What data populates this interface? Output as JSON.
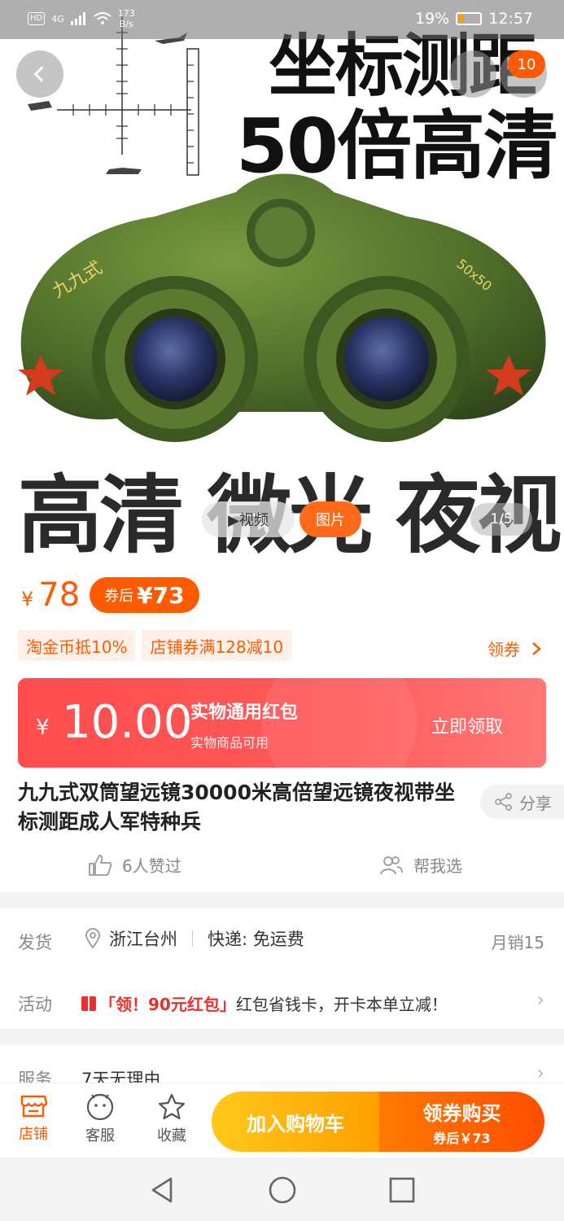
{
  "status_bar": {
    "hd": "HD",
    "network": "4G",
    "speed_value": "173",
    "speed_unit": "B/s",
    "battery": "19%",
    "time": "12:57"
  },
  "hero": {
    "title_line1": "坐标测距",
    "title_line2": "50倍高清",
    "bottom_text": "高清 微光 夜视",
    "cart_badge": "10",
    "tab_video": "▶视频",
    "tab_picture": "图片",
    "page_indicator": "1/5",
    "binocular_model_text": "九九式",
    "binocular_spec_text": "50x50"
  },
  "price": {
    "symbol": "¥",
    "value": "78",
    "coupon_label": "券后",
    "coupon_value": "¥73"
  },
  "tags": [
    "淘金币抵10%",
    "店铺券满128减10"
  ],
  "get_coupon": "领券",
  "red_packet": {
    "symbol": "¥",
    "amount": "10.00",
    "title": "实物通用红包",
    "subtitle": "实物商品可用",
    "action": "立即领取"
  },
  "product": {
    "title": "九九式双筒望远镜30000米高倍望远镜夜视带坐标测距成人军特种兵",
    "share": "分享",
    "likes": "6人赞过",
    "help_choose": "帮我选"
  },
  "shipping": {
    "label": "发货",
    "location": "浙江台州",
    "express": "快递: 免运费",
    "monthly_sales": "月销15"
  },
  "activity": {
    "label": "活动",
    "highlight": "「领！90元红包」",
    "text": "红包省钱卡，开卡本单立减！"
  },
  "service": {
    "label": "服务",
    "text": "7天无理由"
  },
  "bottom_bar": {
    "shop": "店铺",
    "customer_service": "客服",
    "favorite": "收藏",
    "add_to_cart": "加入购物车",
    "buy_main": "领券购买",
    "buy_sub": "券后￥73"
  },
  "colors": {
    "accent": "#ff5a00",
    "red_packet": "#ff4d4d",
    "cart_button": "#ffb000",
    "buy_button": "#ff6a00"
  }
}
